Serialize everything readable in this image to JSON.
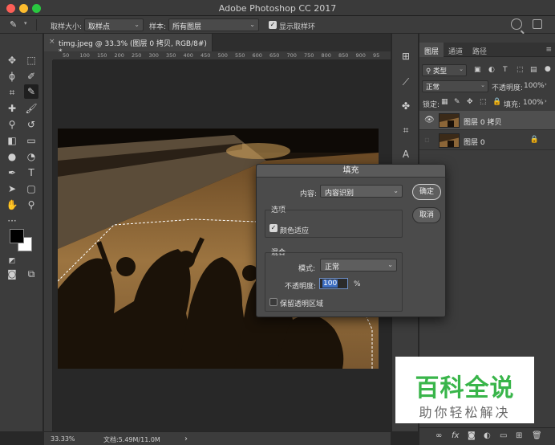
{
  "app": {
    "title": "Adobe Photoshop CC 2017"
  },
  "options_bar": {
    "sample_size_label": "取样大小:",
    "sample_size_value": "取样点",
    "sample_label": "样本:",
    "sample_value": "所有图层",
    "show_ring_label": "显示取样环",
    "show_ring_checked": true
  },
  "document": {
    "tab_title": "timg.jpeg @ 33.3% (图层 0 拷贝, RGB/8#) *",
    "ruler_marks": [
      "50",
      "100",
      "150",
      "200",
      "250",
      "300",
      "350",
      "400",
      "450",
      "500",
      "550",
      "600",
      "650",
      "700",
      "750",
      "800",
      "850",
      "900",
      "95"
    ]
  },
  "status_bar": {
    "zoom": "33.33%",
    "doc_info": "文档:5.49M/11.0M",
    "arrow": "›"
  },
  "layers_panel": {
    "tabs": [
      "图层",
      "通道",
      "路径"
    ],
    "active_tab": 0,
    "filter_label": "类型",
    "blend_mode": "正常",
    "opacity_label": "不透明度:",
    "opacity_value": "100%",
    "lock_label": "锁定:",
    "fill_label": "填充:",
    "fill_value": "100%",
    "layers": [
      {
        "name": "图层 0 拷贝",
        "visible": true,
        "selected": true,
        "locked": false
      },
      {
        "name": "图层 0",
        "visible": false,
        "selected": false,
        "locked": true
      }
    ],
    "bottom_fx": "fx"
  },
  "fill_dialog": {
    "title": "填充",
    "content_label": "内容:",
    "content_value": "内容识别",
    "ok_label": "确定",
    "cancel_label": "取消",
    "options_group": "选项",
    "color_adapt_label": "颜色适应",
    "color_adapt_checked": true,
    "blend_group": "混合",
    "mode_label": "模式:",
    "mode_value": "正常",
    "opacity_label": "不透明度:",
    "opacity_value": "100",
    "opacity_unit": "%",
    "preserve_label": "保留透明区域",
    "preserve_checked": false
  },
  "watermark": {
    "title": "百科全说",
    "subtitle": "助你轻松解决"
  },
  "colors": {
    "fg": "#000000",
    "bg": "#ffffff",
    "watermark_green": "#39b54a"
  }
}
